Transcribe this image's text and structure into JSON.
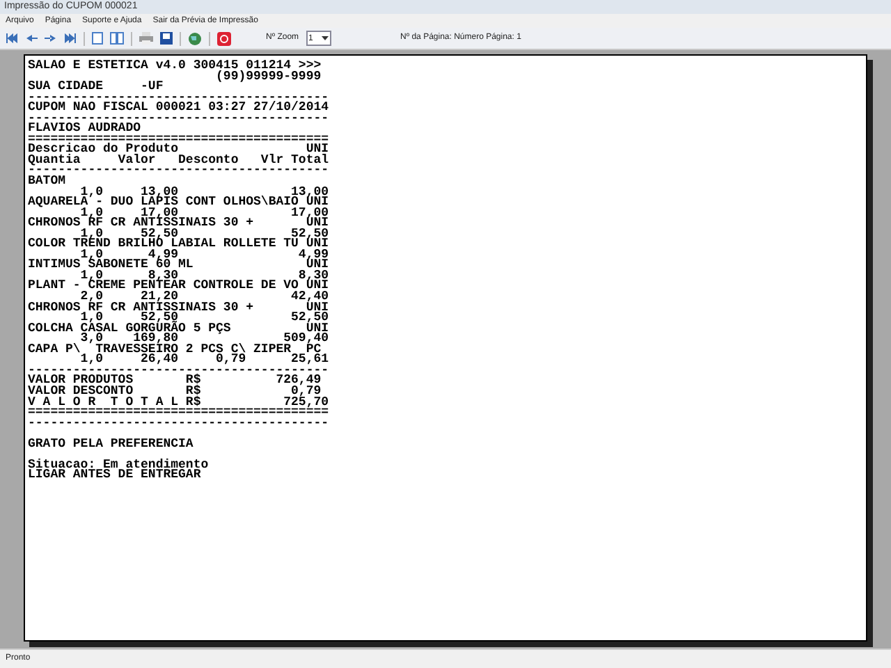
{
  "window": {
    "title": "Impressão do CUPOM 000021"
  },
  "menu": [
    "Arquivo",
    "Página",
    "Suporte e Ajuda",
    "Sair da Prévia de Impressão"
  ],
  "toolbar": {
    "zoom_label": "Nº Zoom",
    "zoom_value": "1",
    "page_label": "Nº da Página: Número Página: 1"
  },
  "receipt": {
    "lines": [
      "SALAO E ESTETICA v4.0 300415 011214 >>>",
      "                         (99)99999-9999",
      "SUA CIDADE     -UF",
      "----------------------------------------",
      "CUPOM NAO FISCAL 000021 03:27 27/10/2014",
      "----------------------------------------",
      "FLAVIOS AUDRADO",
      "========================================",
      "Descricao do Produto                 UNI",
      "Quantia     Valor   Desconto   Vlr Total",
      "----------------------------------------",
      "BATOM",
      "       1,0     13,00               13,00",
      "AQUARELA - DUO LAPIS CONT OLHOS\\BAIO UNI",
      "       1,0     17,00               17,00",
      "CHRONOS RF CR ANTISSINAIS 30 +       UNI",
      "       1,0     52,50               52,50",
      "COLOR TREND BRILHO LABIAL ROLLETE TU UNI",
      "       1,0      4,99                4,99",
      "INTIMUS SABONETE 60 ML               UNI",
      "       1,0      8,30                8,30",
      "PLANT - CREME PENTEAR CONTROLE DE VO UNI",
      "       2,0     21,20               42,40",
      "CHRONOS RF CR ANTISSINAIS 30 +       UNI",
      "       1,0     52,50               52,50",
      "COLCHA CASAL GORGURÃO 5 PÇS          UNI",
      "       3,0    169,80              509,40",
      "CAPA P\\  TRAVESSEIRO 2 PCS C\\ ZIPER  PC",
      "       1,0     26,40     0,79      25,61",
      "----------------------------------------",
      "VALOR PRODUTOS       R$          726,49",
      "VALOR DESCONTO       R$            0,79",
      "V A L O R  T O T A L R$           725,70",
      "========================================",
      "----------------------------------------"
    ],
    "footer_paragraphs": [
      [
        "GRATO PELA PREFERENCIA"
      ],
      [
        "Situacao: Em atendimento",
        "LIGAR ANTES DE ENTREGAR"
      ]
    ]
  },
  "status_bar": "Pronto"
}
